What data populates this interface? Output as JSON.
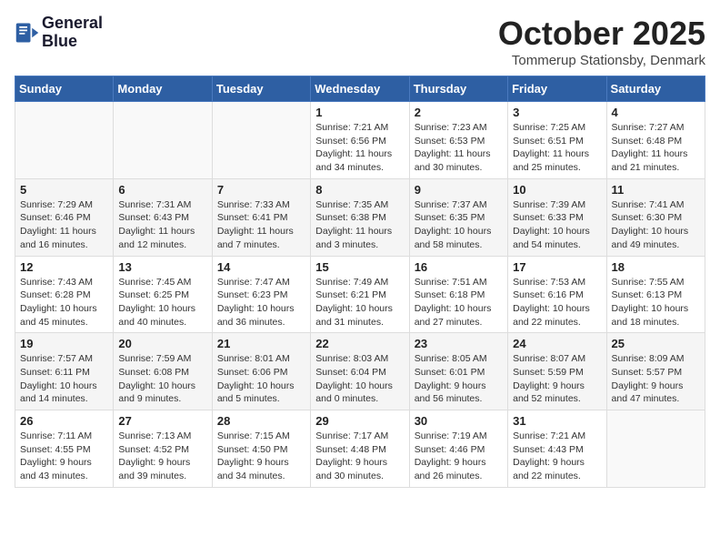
{
  "header": {
    "logo_line1": "General",
    "logo_line2": "Blue",
    "month": "October 2025",
    "location": "Tommerup Stationsby, Denmark"
  },
  "weekdays": [
    "Sunday",
    "Monday",
    "Tuesday",
    "Wednesday",
    "Thursday",
    "Friday",
    "Saturday"
  ],
  "weeks": [
    [
      {
        "day": "",
        "info": ""
      },
      {
        "day": "",
        "info": ""
      },
      {
        "day": "",
        "info": ""
      },
      {
        "day": "1",
        "info": "Sunrise: 7:21 AM\nSunset: 6:56 PM\nDaylight: 11 hours\nand 34 minutes."
      },
      {
        "day": "2",
        "info": "Sunrise: 7:23 AM\nSunset: 6:53 PM\nDaylight: 11 hours\nand 30 minutes."
      },
      {
        "day": "3",
        "info": "Sunrise: 7:25 AM\nSunset: 6:51 PM\nDaylight: 11 hours\nand 25 minutes."
      },
      {
        "day": "4",
        "info": "Sunrise: 7:27 AM\nSunset: 6:48 PM\nDaylight: 11 hours\nand 21 minutes."
      }
    ],
    [
      {
        "day": "5",
        "info": "Sunrise: 7:29 AM\nSunset: 6:46 PM\nDaylight: 11 hours\nand 16 minutes."
      },
      {
        "day": "6",
        "info": "Sunrise: 7:31 AM\nSunset: 6:43 PM\nDaylight: 11 hours\nand 12 minutes."
      },
      {
        "day": "7",
        "info": "Sunrise: 7:33 AM\nSunset: 6:41 PM\nDaylight: 11 hours\nand 7 minutes."
      },
      {
        "day": "8",
        "info": "Sunrise: 7:35 AM\nSunset: 6:38 PM\nDaylight: 11 hours\nand 3 minutes."
      },
      {
        "day": "9",
        "info": "Sunrise: 7:37 AM\nSunset: 6:35 PM\nDaylight: 10 hours\nand 58 minutes."
      },
      {
        "day": "10",
        "info": "Sunrise: 7:39 AM\nSunset: 6:33 PM\nDaylight: 10 hours\nand 54 minutes."
      },
      {
        "day": "11",
        "info": "Sunrise: 7:41 AM\nSunset: 6:30 PM\nDaylight: 10 hours\nand 49 minutes."
      }
    ],
    [
      {
        "day": "12",
        "info": "Sunrise: 7:43 AM\nSunset: 6:28 PM\nDaylight: 10 hours\nand 45 minutes."
      },
      {
        "day": "13",
        "info": "Sunrise: 7:45 AM\nSunset: 6:25 PM\nDaylight: 10 hours\nand 40 minutes."
      },
      {
        "day": "14",
        "info": "Sunrise: 7:47 AM\nSunset: 6:23 PM\nDaylight: 10 hours\nand 36 minutes."
      },
      {
        "day": "15",
        "info": "Sunrise: 7:49 AM\nSunset: 6:21 PM\nDaylight: 10 hours\nand 31 minutes."
      },
      {
        "day": "16",
        "info": "Sunrise: 7:51 AM\nSunset: 6:18 PM\nDaylight: 10 hours\nand 27 minutes."
      },
      {
        "day": "17",
        "info": "Sunrise: 7:53 AM\nSunset: 6:16 PM\nDaylight: 10 hours\nand 22 minutes."
      },
      {
        "day": "18",
        "info": "Sunrise: 7:55 AM\nSunset: 6:13 PM\nDaylight: 10 hours\nand 18 minutes."
      }
    ],
    [
      {
        "day": "19",
        "info": "Sunrise: 7:57 AM\nSunset: 6:11 PM\nDaylight: 10 hours\nand 14 minutes."
      },
      {
        "day": "20",
        "info": "Sunrise: 7:59 AM\nSunset: 6:08 PM\nDaylight: 10 hours\nand 9 minutes."
      },
      {
        "day": "21",
        "info": "Sunrise: 8:01 AM\nSunset: 6:06 PM\nDaylight: 10 hours\nand 5 minutes."
      },
      {
        "day": "22",
        "info": "Sunrise: 8:03 AM\nSunset: 6:04 PM\nDaylight: 10 hours\nand 0 minutes."
      },
      {
        "day": "23",
        "info": "Sunrise: 8:05 AM\nSunset: 6:01 PM\nDaylight: 9 hours\nand 56 minutes."
      },
      {
        "day": "24",
        "info": "Sunrise: 8:07 AM\nSunset: 5:59 PM\nDaylight: 9 hours\nand 52 minutes."
      },
      {
        "day": "25",
        "info": "Sunrise: 8:09 AM\nSunset: 5:57 PM\nDaylight: 9 hours\nand 47 minutes."
      }
    ],
    [
      {
        "day": "26",
        "info": "Sunrise: 7:11 AM\nSunset: 4:55 PM\nDaylight: 9 hours\nand 43 minutes."
      },
      {
        "day": "27",
        "info": "Sunrise: 7:13 AM\nSunset: 4:52 PM\nDaylight: 9 hours\nand 39 minutes."
      },
      {
        "day": "28",
        "info": "Sunrise: 7:15 AM\nSunset: 4:50 PM\nDaylight: 9 hours\nand 34 minutes."
      },
      {
        "day": "29",
        "info": "Sunrise: 7:17 AM\nSunset: 4:48 PM\nDaylight: 9 hours\nand 30 minutes."
      },
      {
        "day": "30",
        "info": "Sunrise: 7:19 AM\nSunset: 4:46 PM\nDaylight: 9 hours\nand 26 minutes."
      },
      {
        "day": "31",
        "info": "Sunrise: 7:21 AM\nSunset: 4:43 PM\nDaylight: 9 hours\nand 22 minutes."
      },
      {
        "day": "",
        "info": ""
      }
    ]
  ]
}
